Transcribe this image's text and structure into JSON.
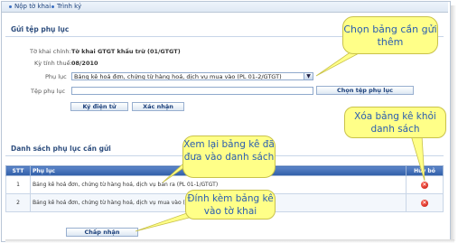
{
  "tabs": [
    {
      "label": "Nộp tờ khai"
    },
    {
      "label": "Trình ký"
    }
  ],
  "attach_section": {
    "title": "Gửi tệp phụ lục",
    "main_form_label": "Tờ khai chính:",
    "main_form_value": "Tờ khai GTGT khấu trừ (01/GTGT)",
    "period_label": "Kỳ tính thuế:",
    "period_value": "08/2010",
    "appendix_label": "Phụ lục",
    "appendix_selected": "Bảng kê hoá đơn, chứng từ hàng hoá, dịch vụ mua vào (PL 01-2/GTGT)",
    "file_label": "Tệp phụ lục",
    "file_value": "",
    "choose_file_button": "Chọn tệp phụ lục",
    "sign_button": "Ký điện tử",
    "confirm_button": "Xác nhận"
  },
  "list_section": {
    "title": "Danh sách phụ lục cần gửi",
    "columns": [
      "STT",
      "Phụ lục",
      "Hủy bỏ"
    ],
    "rows": [
      {
        "stt": "1",
        "appendix": "Bảng kê hoá đơn, chứng từ hàng hoá, dịch vụ bán ra (PL 01-1/GTGT)"
      },
      {
        "stt": "2",
        "appendix": "Bảng kê hoá đơn, chứng từ hàng hoá, dịch vụ mua vào (PL 01-2/GTGT)"
      }
    ],
    "accept_button": "Chấp nhận"
  },
  "callouts": {
    "select_table": "Chọn bảng cần gửi thêm",
    "remove_table": "Xóa bảng kê khỏi danh sách",
    "review_table": "Xem lại bảng kê đã đưa vào danh sách",
    "attach_table": "Đính kèm bảng kê vào tờ khai"
  },
  "colors": {
    "callout_bg": "#ffff88",
    "callout_text": "#2a5db0",
    "header_blue": "#2f5ea8",
    "delete_red": "#c1150c"
  },
  "icons": {
    "tab_bullet": "bullet-icon",
    "dropdown": "chevron-down-icon",
    "delete": "delete-icon"
  }
}
